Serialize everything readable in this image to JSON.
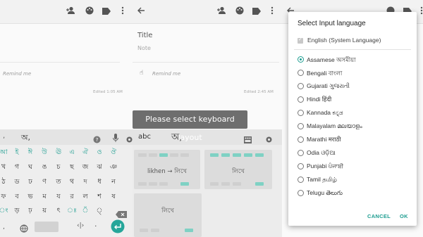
{
  "notes": {
    "left": {
      "remind": "Remind me",
      "edited": "Edited 1:05 AM"
    },
    "middle": {
      "title": "Title",
      "placeholder": "Note",
      "remind": "Remind me",
      "edited": "Edited 2:45 AM"
    }
  },
  "keyboard": {
    "suggest_left": "অ,",
    "row1": [
      "আ",
      "ই",
      "ঈ",
      "উ",
      "ঊ",
      "এ",
      "ঐ",
      "ও",
      "ঔ"
    ],
    "row2": [
      "খ",
      "গ",
      "ঘ",
      "ঙ",
      "চ",
      "ছ",
      "জ",
      "ঝ",
      "ঞ"
    ],
    "row3": [
      "ঠ",
      "ড",
      "ঢ",
      "ণ",
      "ত",
      "থ",
      "দ",
      "ধ",
      "ন"
    ],
    "row4": [
      "ফ",
      "ব",
      "ভ",
      "ম",
      "য",
      "র",
      "ল",
      "শ",
      "ষ"
    ],
    "row5": [
      "ং",
      "ড়",
      "ঢ়",
      "য়",
      "ৎ",
      "ঃ",
      "ঁ",
      "্"
    ],
    "comma": ","
  },
  "layout": {
    "abc": "abc",
    "bengali_sample": "অ,",
    "card1": "likhen → লিখে",
    "card2": "লিখে",
    "card3": "লিখে"
  },
  "tooltip": "Please select keyboard layout",
  "dialog": {
    "title": "Select Input language",
    "system": "English (System Language)",
    "languages": [
      {
        "label": "Assamese অসমীয়া",
        "selected": true
      },
      {
        "label": "Bengali বাংলা",
        "selected": false
      },
      {
        "label": "Gujarati ગુજરાતી",
        "selected": false
      },
      {
        "label": "Hindi हिंदी",
        "selected": false
      },
      {
        "label": "Kannada ಕನ್ನಡ",
        "selected": false
      },
      {
        "label": "Malayalam മലയാളം",
        "selected": false
      },
      {
        "label": "Marathi मराठी",
        "selected": false
      },
      {
        "label": "Odia ଓଡ଼ିଆ",
        "selected": false
      },
      {
        "label": "Punjabi ਪੰਜਾਬੀ",
        "selected": false
      },
      {
        "label": "Tamil தமிழ்",
        "selected": false
      },
      {
        "label": "Telugu తెలుగు",
        "selected": false
      }
    ],
    "cancel": "CANCEL",
    "ok": "OK"
  },
  "colors": {
    "accent": "#1f9e91",
    "tooltip": "#6e6e6e"
  }
}
